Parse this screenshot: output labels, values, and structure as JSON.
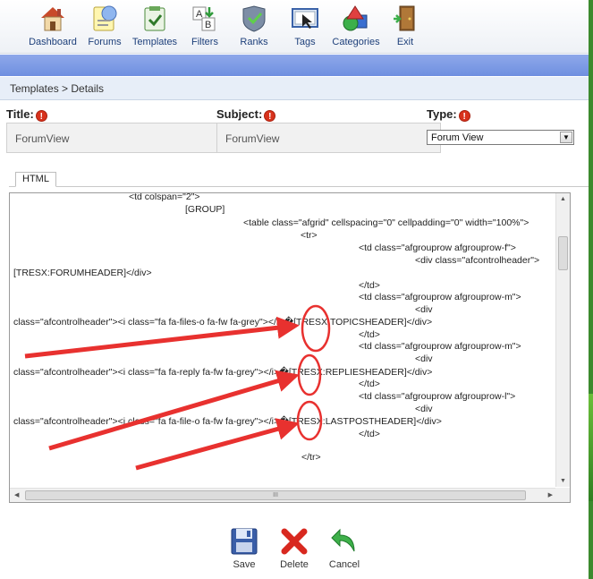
{
  "toolbar": {
    "items": [
      {
        "label": "Dashboard",
        "icon": "home-icon"
      },
      {
        "label": "Forums",
        "icon": "forums-icon"
      },
      {
        "label": "Templates",
        "icon": "templates-icon"
      },
      {
        "label": "Filters",
        "icon": "filters-icon"
      },
      {
        "label": "Ranks",
        "icon": "ranks-icon"
      },
      {
        "label": "Tags",
        "icon": "tags-icon"
      },
      {
        "label": "Categories",
        "icon": "categories-icon"
      },
      {
        "label": "Exit",
        "icon": "exit-icon"
      }
    ]
  },
  "breadcrumb": "Templates > Details",
  "fields": {
    "title_label": "Title:",
    "title_value": "ForumView",
    "subject_label": "Subject:",
    "subject_value": "ForumView",
    "type_label": "Type:",
    "type_value": "Forum View",
    "required_mark": "!"
  },
  "tab": "HTML",
  "code_lines": [
    "<td colspan=\"2\">",
    "[GROUP]",
    "<table class=\"afgrid\" cellspacing=\"0\" cellpadding=\"0\" width=\"100%\">",
    "<tr>",
    "<td class=\"afgrouprow afgrouprow-f\">",
    "<div class=\"afcontrolheader\">",
    "[TRESX:FORUMHEADER]</div>",
    "</td>",
    "<td class=\"afgrouprow afgrouprow-m\">",
    "<div",
    "class=\"afcontrolheader\"><i class=\"fa fa-files-o fa-fw fa-grey\"></i>\u0000[TRESX:TOPICSHEADER]</div>",
    "</td>",
    "<td class=\"afgrouprow afgrouprow-m\">",
    "<div",
    "class=\"afcontrolheader\"><i class=\"fa fa-reply fa-fw fa-grey\"></i>\u0000[TRESX:REPLIESHEADER]</div>",
    "</td>",
    "<td class=\"afgrouprow afgrouprow-l\">",
    "<div",
    "class=\"afcontrolheader\"><i class=\"fa fa-file-o fa-fw fa-grey\"></i>\u0000[TRESX:LASTPOSTHEADER]</div>",
    "</td>",
    "</tr>"
  ],
  "scroll_grip": "III",
  "actions": [
    {
      "label": "Save",
      "icon": "save-disk-icon"
    },
    {
      "label": "Delete",
      "icon": "delete-x-icon"
    },
    {
      "label": "Cancel",
      "icon": "cancel-arrow-icon"
    }
  ],
  "colors": {
    "annotation": "#e8312f",
    "toolbar_text": "#1d3f7a",
    "blue_bar": "#7f9be6"
  }
}
